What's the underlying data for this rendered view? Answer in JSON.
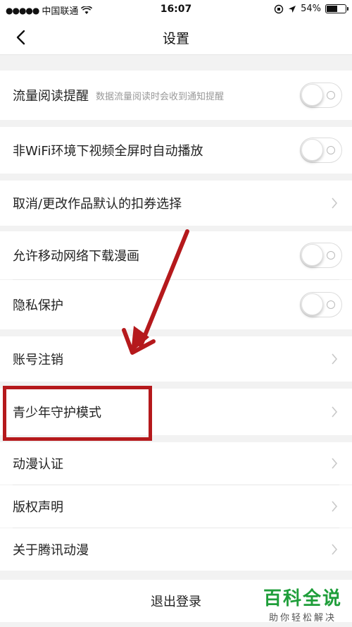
{
  "status_bar": {
    "carrier": "中国联通",
    "time": "16:07",
    "battery_percent": "54%",
    "battery_level": 0.54
  },
  "nav": {
    "back_icon": "chevron-left-icon",
    "title": "设置"
  },
  "settings": [
    {
      "label": "流量阅读提醒",
      "sub": "数据流量阅读时会收到通知提醒",
      "control": "toggle",
      "on": false
    },
    {
      "label": "非WiFi环境下视频全屏时自动播放",
      "control": "toggle",
      "on": false
    },
    {
      "label": "取消/更改作品默认的扣券选择",
      "control": "chevron"
    },
    {
      "label": "允许移动网络下载漫画",
      "control": "toggle",
      "on": false
    },
    {
      "label": "隐私保护",
      "control": "toggle",
      "on": false
    },
    {
      "label": "账号注销",
      "control": "chevron"
    },
    {
      "label": "青少年守护模式",
      "control": "chevron"
    },
    {
      "label": "动漫认证",
      "control": "chevron"
    },
    {
      "label": "版权声明",
      "control": "chevron"
    },
    {
      "label": "关于腾讯动漫",
      "control": "chevron"
    }
  ],
  "logout": {
    "label": "退出登录"
  },
  "annotation": {
    "color": "#b5191c"
  },
  "watermark": {
    "title": "百科全说",
    "subtitle": "助你轻松解决"
  }
}
